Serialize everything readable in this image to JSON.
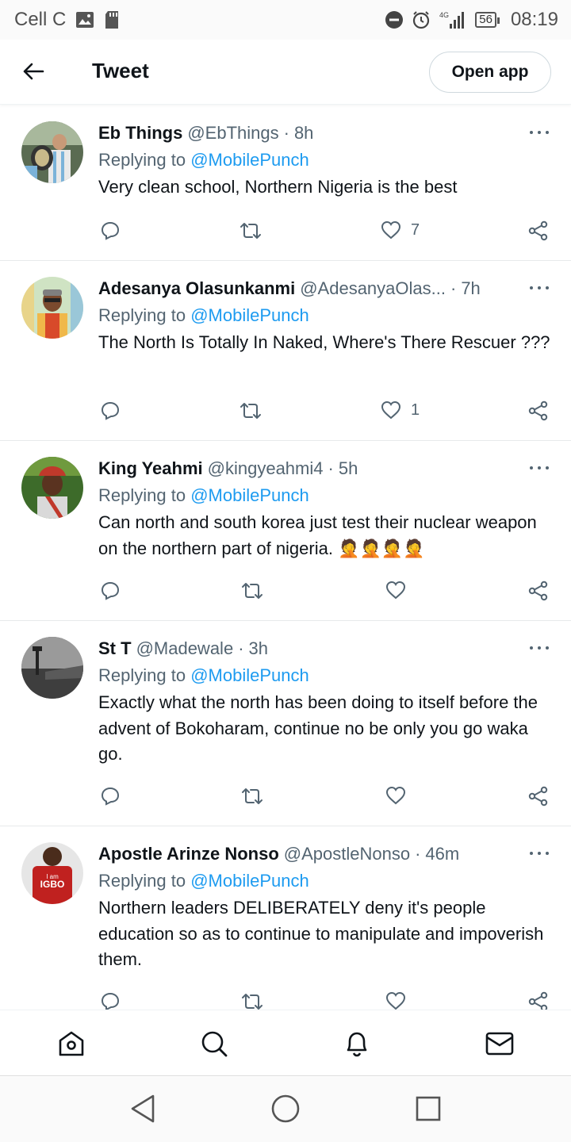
{
  "status_bar": {
    "carrier": "Cell C",
    "network": "4G",
    "battery": "56",
    "time": "08:19",
    "icons": [
      "image-icon",
      "sd-card-icon",
      "do-not-disturb-icon",
      "alarm-icon",
      "signal-icon",
      "battery-icon"
    ]
  },
  "header": {
    "title": "Tweet",
    "open_app_label": "Open app"
  },
  "tweets": [
    {
      "name": "Eb Things",
      "handle": "@EbThings",
      "dot": "·",
      "time": "8h",
      "replying_prefix": "Replying to",
      "replying_to": "@MobilePunch",
      "text": "Very clean school, Northern Nigeria is the best",
      "likes": "7"
    },
    {
      "name": "Adesanya Olasunkanmi",
      "handle": "@AdesanyaOlas...",
      "dot": "·",
      "time": "7h",
      "replying_prefix": "Replying to",
      "replying_to": "@MobilePunch",
      "text": "The North Is Totally In Naked, Where's There Rescuer ???",
      "likes": "1"
    },
    {
      "name": "King Yeahmi",
      "handle": "@kingyeahmi4",
      "dot": "·",
      "time": "5h",
      "replying_prefix": "Replying to",
      "replying_to": "@MobilePunch",
      "text": "Can north and south korea just test their nuclear weapon on the northern part of nigeria. 🤦🤦🤦🤦",
      "likes": ""
    },
    {
      "name": "St T",
      "handle": "@Madewale",
      "dot": "·",
      "time": "3h",
      "replying_prefix": "Replying to",
      "replying_to": "@MobilePunch",
      "text": "Exactly what the north has been doing to itself before the advent of Bokoharam, continue no be only you go waka go.",
      "likes": ""
    },
    {
      "name": "Apostle Arinze Nonso",
      "handle": "@ApostleNonso",
      "dot": "·",
      "time": "46m",
      "replying_prefix": "Replying to",
      "replying_to": "@MobilePunch",
      "text": "Northern leaders DELIBERATELY deny it's people education so as to continue to manipulate and impoverish them.",
      "likes": "",
      "avatar_text": "I am IGBO"
    }
  ],
  "colors": {
    "link": "#1d9bf0",
    "secondary_text": "#536471",
    "primary_text": "#0f1419",
    "divider": "#e7eaeb"
  },
  "bottom_nav": [
    "home-icon",
    "search-icon",
    "notifications-icon",
    "messages-icon"
  ],
  "system_nav": [
    "back-triangle-icon",
    "home-circle-icon",
    "recents-square-icon"
  ]
}
